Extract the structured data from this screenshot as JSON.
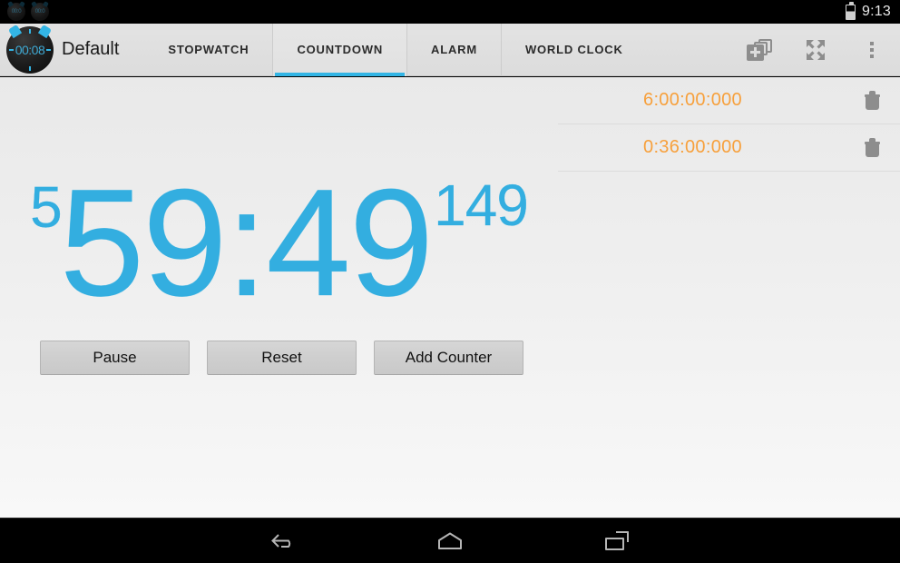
{
  "statusbar": {
    "notifications": [
      {
        "icon": "timer-notification-icon",
        "label": "00:0"
      },
      {
        "icon": "timer-notification-icon",
        "label": "00:0"
      }
    ],
    "battery_icon": "battery-icon",
    "time": "9:13"
  },
  "actionbar": {
    "app_icon": "stopwatch-app-icon",
    "app_icon_time": "00:08",
    "title": "Default",
    "tabs": [
      {
        "label": "STOPWATCH",
        "active": false
      },
      {
        "label": "COUNTDOWN",
        "active": true
      },
      {
        "label": "ALARM",
        "active": false
      },
      {
        "label": "WORLD CLOCK",
        "active": false
      }
    ],
    "actions": [
      {
        "name": "add-counter-icon",
        "label": "Add counter"
      },
      {
        "name": "fullscreen-icon",
        "label": "Fullscreen"
      },
      {
        "name": "overflow-menu-icon",
        "label": "More options"
      }
    ],
    "accent_color": "#33b5e5"
  },
  "countdown": {
    "hours": "5",
    "main": "59:49",
    "millis": "149",
    "color": "#33aee0"
  },
  "buttons": [
    {
      "label": "Pause",
      "name": "pause-button"
    },
    {
      "label": "Reset",
      "name": "reset-button"
    },
    {
      "label": "Add Counter",
      "name": "add-counter-button"
    }
  ],
  "presets": {
    "accent_color": "#f7a03c",
    "rows": [
      {
        "time": "6:00:00:000",
        "delete_icon": "trash-icon"
      },
      {
        "time": "0:36:00:000",
        "delete_icon": "trash-icon"
      }
    ]
  },
  "navbar": {
    "buttons": [
      {
        "name": "nav-back-button",
        "icon": "back-arrow-icon"
      },
      {
        "name": "nav-home-button",
        "icon": "home-icon"
      },
      {
        "name": "nav-recents-button",
        "icon": "recents-icon"
      }
    ]
  }
}
